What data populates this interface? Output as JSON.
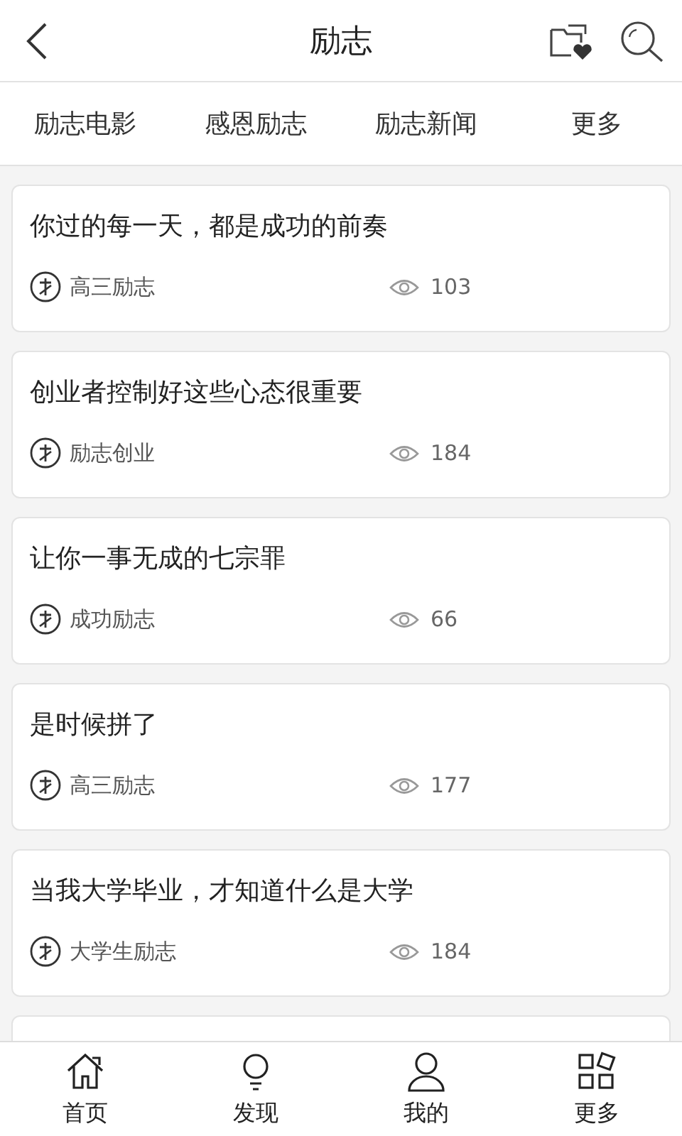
{
  "header": {
    "title": "励志"
  },
  "tabs": [
    "励志电影",
    "感恩励志",
    "励志新闻",
    "更多"
  ],
  "articles": [
    {
      "title": "你过的每一天，都是成功的前奏",
      "source": "高三励志",
      "views": "103"
    },
    {
      "title": "创业者控制好这些心态很重要",
      "source": "励志创业",
      "views": "184"
    },
    {
      "title": "让你一事无成的七宗罪",
      "source": "成功励志",
      "views": "66"
    },
    {
      "title": "是时候拼了",
      "source": "高三励志",
      "views": "177"
    },
    {
      "title": "当我大学毕业，才知道什么是大学",
      "source": "大学生励志",
      "views": "184"
    }
  ],
  "bottom_nav": [
    {
      "kind": "home",
      "label": "首页"
    },
    {
      "kind": "discover",
      "label": "发现"
    },
    {
      "kind": "profile",
      "label": "我的"
    },
    {
      "kind": "more",
      "label": "更多"
    }
  ]
}
